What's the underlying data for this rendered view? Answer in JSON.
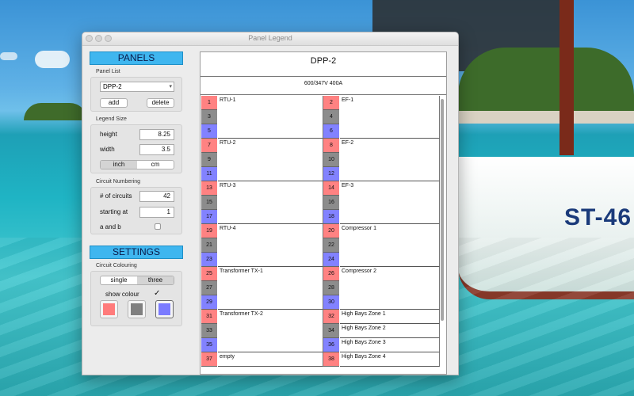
{
  "window": {
    "title": "Panel Legend"
  },
  "background": {
    "boat_label": "ST-46"
  },
  "sidebar": {
    "panels_header": "PANELS",
    "panel_list_label": "Panel List",
    "panel_select_value": "DPP-2",
    "add_label": "add",
    "delete_label": "delete",
    "legend_size_label": "Legend Size",
    "height_label": "height",
    "height_value": "8.25",
    "width_label": "width",
    "width_value": "3.5",
    "units": [
      "inch",
      "cm"
    ],
    "units_selected": "inch",
    "circuit_numbering_label": "Circuit Numbering",
    "num_circuits_label": "# of circuits",
    "num_circuits_value": "42",
    "starting_at_label": "starting at",
    "starting_at_value": "1",
    "a_and_b_label": "a and b",
    "a_and_b_checked": false,
    "settings_header": "SETTINGS",
    "circuit_colouring_label": "Circuit Colouring",
    "colouring_modes": [
      "single",
      "three"
    ],
    "colouring_selected": "three",
    "show_colour_label": "show colour",
    "show_colour_checked": true,
    "swatches": [
      "#ff7b7b",
      "#808080",
      "#7b7bff"
    ]
  },
  "legend": {
    "title": "DPP-2",
    "subtitle": "600/347V 400A",
    "phase_colors": [
      "#ff8282",
      "#8c8c8c",
      "#8282ff"
    ],
    "left": [
      {
        "numbers": [
          "1",
          "3",
          "5"
        ],
        "label": "RTU-1"
      },
      {
        "numbers": [
          "7",
          "9",
          "11"
        ],
        "label": "RTU-2"
      },
      {
        "numbers": [
          "13",
          "15",
          "17"
        ],
        "label": "RTU-3"
      },
      {
        "numbers": [
          "19",
          "21",
          "23"
        ],
        "label": "RTU-4"
      },
      {
        "numbers": [
          "25",
          "27",
          "29"
        ],
        "label": "Transformer TX-1"
      },
      {
        "numbers": [
          "31",
          "33",
          "35"
        ],
        "label": "Transformer TX-2"
      },
      {
        "numbers": [
          "37"
        ],
        "label": "empty"
      }
    ],
    "right": [
      {
        "numbers": [
          "2",
          "4",
          "6"
        ],
        "label": "EF-1"
      },
      {
        "numbers": [
          "8",
          "10",
          "12"
        ],
        "label": "EF-2"
      },
      {
        "numbers": [
          "14",
          "16",
          "18"
        ],
        "label": "EF-3"
      },
      {
        "numbers": [
          "20",
          "22",
          "24"
        ],
        "label": "Compressor 1"
      },
      {
        "numbers": [
          "26",
          "28",
          "30"
        ],
        "label": "Compressor 2"
      },
      {
        "numbers": [
          "32"
        ],
        "label": "High Bays Zone 1"
      },
      {
        "numbers": [
          "34"
        ],
        "label": "High Bays Zone 2"
      },
      {
        "numbers": [
          "36"
        ],
        "label": "High Bays Zone 3"
      },
      {
        "numbers": [
          "38"
        ],
        "label": "High Bays Zone 4"
      }
    ]
  }
}
